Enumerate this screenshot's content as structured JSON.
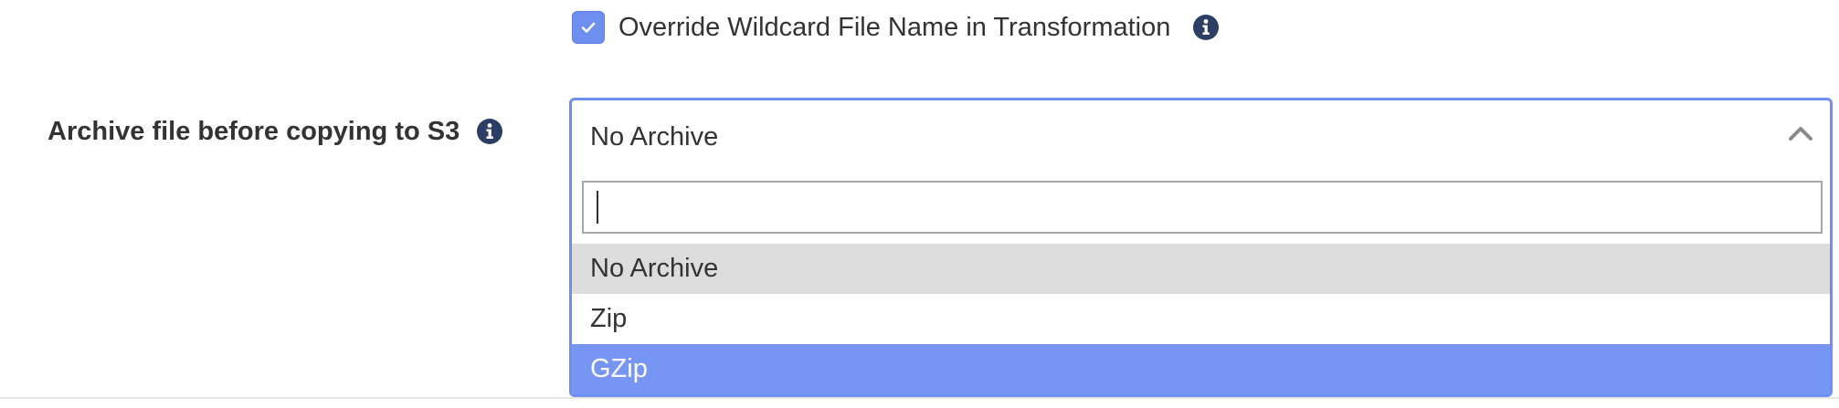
{
  "override_wildcard": {
    "label": "Override Wildcard File Name in Transformation",
    "checked": true,
    "info_icon": "info-icon"
  },
  "archive_field": {
    "label": "Archive file before copying to S3",
    "info_icon": "info-icon",
    "selected_value": "No Archive",
    "search": {
      "value": "",
      "placeholder": ""
    },
    "options": [
      {
        "label": "No Archive",
        "state": "selected"
      },
      {
        "label": "Zip",
        "state": "normal"
      },
      {
        "label": "GZip",
        "state": "highlighted"
      }
    ]
  },
  "colors": {
    "accent": "#6e8fef",
    "highlight": "#7796f3",
    "selected_row": "#dddddd",
    "info_icon": "#2c3e66"
  }
}
